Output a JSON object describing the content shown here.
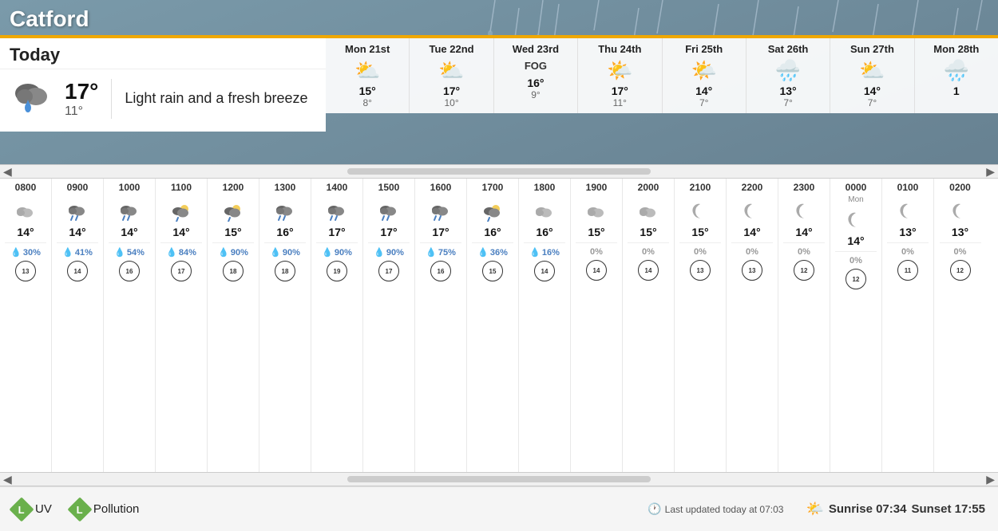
{
  "city": "Catford",
  "today": {
    "title": "Today",
    "high": "17°",
    "low": "11°",
    "description": "Light rain and a fresh breeze",
    "icon": "🌧️"
  },
  "forecast": [
    {
      "day": "Mon 21st",
      "icon": "⛅",
      "high": "15°",
      "low": "8°",
      "fog": false
    },
    {
      "day": "Tue 22nd",
      "icon": "⛅",
      "high": "17°",
      "low": "10°",
      "fog": false
    },
    {
      "day": "Wed 23rd",
      "icon": "",
      "high": "16°",
      "low": "9°",
      "fog": true,
      "fogLabel": "FOG"
    },
    {
      "day": "Thu 24th",
      "icon": "🌤️",
      "high": "17°",
      "low": "11°",
      "fog": false
    },
    {
      "day": "Fri 25th",
      "icon": "🌤️",
      "high": "14°",
      "low": "7°",
      "fog": false
    },
    {
      "day": "Sat 26th",
      "icon": "🌧️",
      "high": "13°",
      "low": "7°",
      "fog": false
    },
    {
      "day": "Sun 27th",
      "icon": "⛅",
      "high": "14°",
      "low": "7°",
      "fog": false
    },
    {
      "day": "Mon 28th",
      "icon": "🌧️",
      "high": "1",
      "low": "",
      "fog": false
    }
  ],
  "hourly": [
    {
      "time": "0800",
      "sublabel": "",
      "icon": "🌥️",
      "iconClass": "cloud-gray",
      "temp": "14°",
      "rain": "30%",
      "rainDrops": true,
      "wind": "13"
    },
    {
      "time": "0900",
      "sublabel": "",
      "icon": "🌧️",
      "iconClass": "cloud-rain",
      "temp": "14°",
      "rain": "41%",
      "rainDrops": true,
      "wind": "14"
    },
    {
      "time": "1000",
      "sublabel": "",
      "icon": "🌧️",
      "iconClass": "cloud-rain",
      "temp": "14°",
      "rain": "54%",
      "rainDrops": true,
      "wind": "16"
    },
    {
      "time": "1100",
      "sublabel": "",
      "icon": "🌦️",
      "iconClass": "cloud-blue",
      "temp": "14°",
      "rain": "84%",
      "rainDrops": true,
      "wind": "17"
    },
    {
      "time": "1200",
      "sublabel": "",
      "icon": "🌦️",
      "iconClass": "cloud-blue",
      "temp": "15°",
      "rain": "90%",
      "rainDrops": true,
      "wind": "18"
    },
    {
      "time": "1300",
      "sublabel": "",
      "icon": "🌧️",
      "iconClass": "cloud-rain",
      "temp": "16°",
      "rain": "90%",
      "rainDrops": true,
      "wind": "18"
    },
    {
      "time": "1400",
      "sublabel": "",
      "icon": "🌧️",
      "iconClass": "cloud-rain",
      "temp": "17°",
      "rain": "90%",
      "rainDrops": true,
      "wind": "19"
    },
    {
      "time": "1500",
      "sublabel": "",
      "icon": "🌧️",
      "iconClass": "cloud-rain",
      "temp": "17°",
      "rain": "90%",
      "rainDrops": true,
      "wind": "17"
    },
    {
      "time": "1600",
      "sublabel": "",
      "icon": "🌧️",
      "iconClass": "cloud-rain",
      "temp": "17°",
      "rain": "75%",
      "rainDrops": true,
      "wind": "16"
    },
    {
      "time": "1700",
      "sublabel": "",
      "icon": "🌦️",
      "iconClass": "cloud-blue",
      "temp": "16°",
      "rain": "36%",
      "rainDrops": true,
      "wind": "15"
    },
    {
      "time": "1800",
      "sublabel": "",
      "icon": "☁️",
      "iconClass": "cloud-gray",
      "temp": "16°",
      "rain": "16%",
      "rainDrops": true,
      "wind": "14"
    },
    {
      "time": "1900",
      "sublabel": "",
      "icon": "☁️",
      "iconClass": "cloud-gray",
      "temp": "15°",
      "rain": "0%",
      "rainDrops": false,
      "wind": "14"
    },
    {
      "time": "2000",
      "sublabel": "",
      "icon": "☁️",
      "iconClass": "cloud-gray",
      "temp": "15°",
      "rain": "0%",
      "rainDrops": false,
      "wind": "14"
    },
    {
      "time": "2100",
      "sublabel": "",
      "icon": "🌙",
      "iconClass": "moon-icon",
      "temp": "15°",
      "rain": "0%",
      "rainDrops": false,
      "wind": "13"
    },
    {
      "time": "2200",
      "sublabel": "",
      "icon": "🌙",
      "iconClass": "moon-icon",
      "temp": "14°",
      "rain": "0%",
      "rainDrops": false,
      "wind": "13"
    },
    {
      "time": "2300",
      "sublabel": "",
      "icon": "🌙",
      "iconClass": "moon-icon",
      "temp": "14°",
      "rain": "0%",
      "rainDrops": false,
      "wind": "12"
    },
    {
      "time": "0000",
      "sublabel": "Mon",
      "icon": "🌙",
      "iconClass": "moon-icon",
      "temp": "14°",
      "rain": "0%",
      "rainDrops": false,
      "wind": "12"
    },
    {
      "time": "0100",
      "sublabel": "",
      "icon": "🌙",
      "iconClass": "moon-icon",
      "temp": "13°",
      "rain": "0%",
      "rainDrops": false,
      "wind": "11"
    },
    {
      "time": "0200",
      "sublabel": "",
      "icon": "🌙",
      "iconClass": "moon-icon",
      "temp": "13°",
      "rain": "0%",
      "rainDrops": false,
      "wind": "12"
    }
  ],
  "bottom": {
    "uv_letter": "L",
    "uv_label": "UV",
    "pollution_letter": "L",
    "pollution_label": "Pollution",
    "last_updated": "Last updated today at 07:03",
    "sunrise_label": "Sunrise 07:34",
    "sunset_label": "Sunset 17:55"
  }
}
